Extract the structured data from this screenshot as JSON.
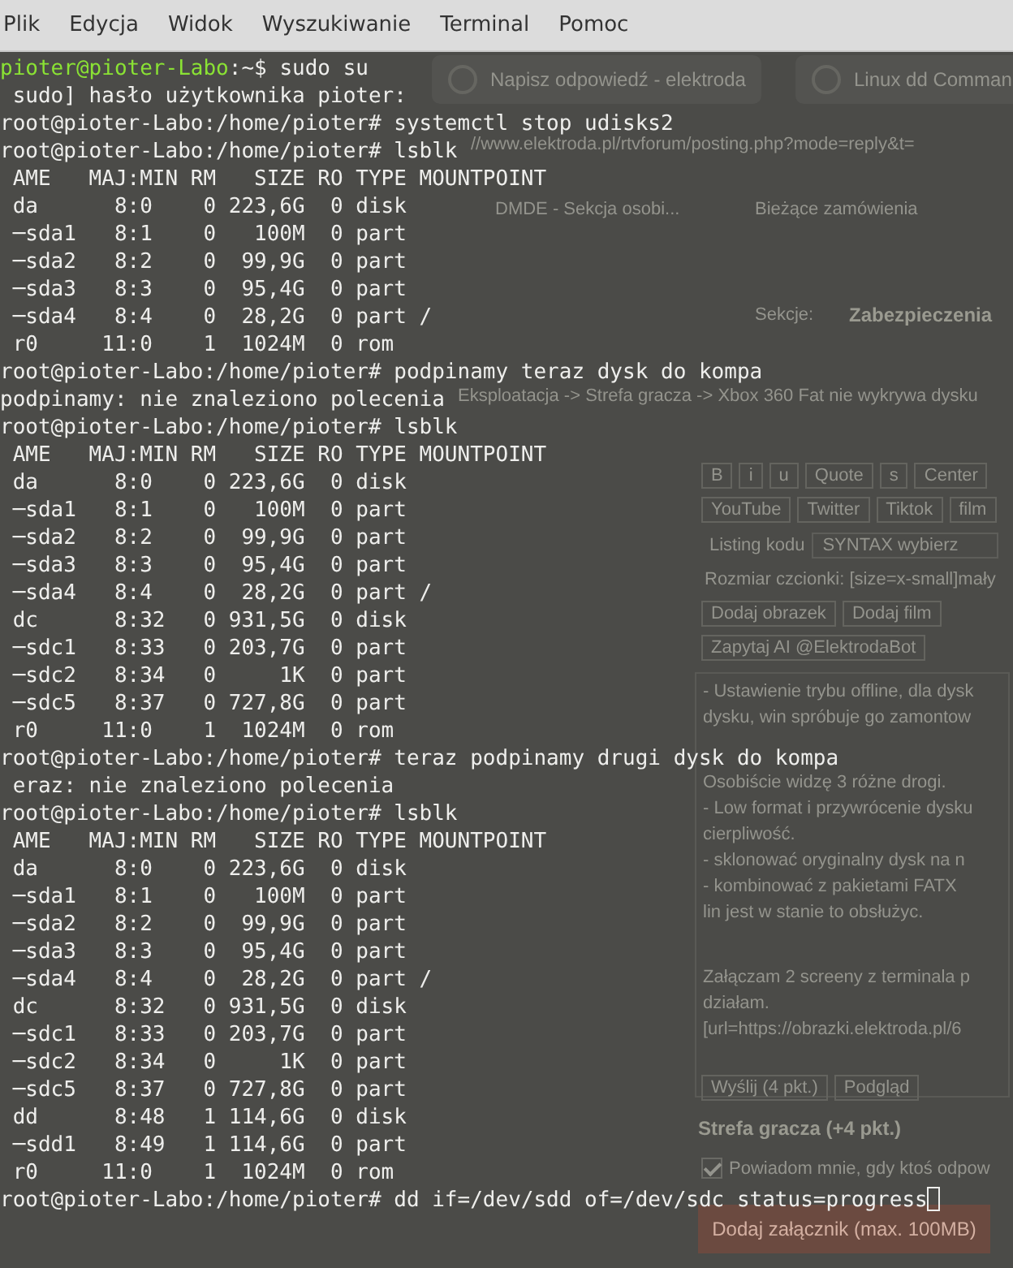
{
  "menu": [
    "Plik",
    "Edycja",
    "Widok",
    "Wyszukiwanie",
    "Terminal",
    "Pomoc"
  ],
  "background_window": [
    {
      "kind": "tab",
      "text": "Napisz odpowiedź - elektroda"
    },
    {
      "kind": "tab",
      "text": "Linux dd Comman"
    },
    {
      "kind": "url",
      "text": "//www.elektroda.pl/rtvforum/posting.php?mode=reply&t="
    },
    {
      "kind": "bookmark",
      "text": "DMDE - Sekcja osobi..."
    },
    {
      "kind": "bookmark",
      "text": "Bieżące zamówienia"
    },
    {
      "kind": "label",
      "text": "Sekcje:"
    },
    {
      "kind": "heading",
      "text": "Zabezpieczenia"
    },
    {
      "kind": "label",
      "text": "Eksploatacja -> Strefa gracza -> Xbox 360 Fat nie wykrywa dysku"
    },
    {
      "kind": "toolbar",
      "items": [
        "B",
        "i",
        "u",
        "Quote",
        "s",
        "Center"
      ]
    },
    {
      "kind": "toolbar",
      "items": [
        "YouTube",
        "Twitter",
        "Tiktok",
        "film"
      ]
    },
    {
      "kind": "select_row",
      "label": "Listing kodu",
      "value": "SYNTAX wybierz"
    },
    {
      "kind": "label",
      "text": "Rozmiar czcionki: [size=x-small]mały"
    },
    {
      "kind": "toolbar",
      "items": [
        "Dodaj obrazek",
        "Dodaj film"
      ]
    },
    {
      "kind": "toolbar",
      "items": [
        "Zapytaj AI @ElektrodaBot"
      ]
    },
    {
      "kind": "textarea",
      "paragraphs": [
        [
          "- Ustawienie trybu offline, dla dysk",
          "dysku, win spróbuje go zamontow"
        ],
        [
          "Osobiście widzę 3 różne drogi.",
          "- Low format i przywrócenie dysku",
          "cierpliwość.",
          "- sklonować oryginalny dysk na n",
          "- kombinować z pakietami FATX",
          "lin jest w stanie to obsłużyc."
        ],
        [
          "Załączam 2 screeny z terminala p",
          "działam.",
          "[url=https://obrazki.elektroda.pl/6"
        ]
      ]
    },
    {
      "kind": "toolbar",
      "items": [
        "Wyślij (4 pkt.)",
        "Podgląd"
      ]
    },
    {
      "kind": "heading",
      "text": "Strefa gracza (+4 pkt.)"
    },
    {
      "kind": "checkbox",
      "text": "Powiadom mnie, gdy ktoś odpow",
      "checked": true
    },
    {
      "kind": "submit",
      "text": "Dodaj załącznik (max. 100MB)"
    }
  ],
  "terminal": {
    "lines": [
      {
        "kind": "user_prompt",
        "user_host": "pioter@pioter-Labo",
        "prompt": ":~$",
        "command": "sudo su"
      },
      {
        "kind": "output",
        "text": " sudo] hasło użytkownika pioter:"
      },
      {
        "kind": "root_prompt",
        "text": "root@pioter-Labo:/home/pioter# systemctl stop udisks2"
      },
      {
        "kind": "root_prompt",
        "text": "root@pioter-Labo:/home/pioter# lsblk"
      },
      {
        "kind": "output",
        "text": " AME   MAJ:MIN RM   SIZE RO TYPE MOUNTPOINT"
      },
      {
        "kind": "output",
        "text": " da      8:0    0 223,6G  0 disk"
      },
      {
        "kind": "output",
        "text": " ─sda1   8:1    0   100M  0 part"
      },
      {
        "kind": "output",
        "text": " ─sda2   8:2    0  99,9G  0 part"
      },
      {
        "kind": "output",
        "text": " ─sda3   8:3    0  95,4G  0 part"
      },
      {
        "kind": "output",
        "text": " ─sda4   8:4    0  28,2G  0 part /"
      },
      {
        "kind": "output",
        "text": " r0     11:0    1  1024M  0 rom"
      },
      {
        "kind": "root_prompt",
        "text": "root@pioter-Labo:/home/pioter# podpinamy teraz dysk do kompa"
      },
      {
        "kind": "output",
        "text": "podpinamy: nie znaleziono polecenia"
      },
      {
        "kind": "root_prompt",
        "text": "root@pioter-Labo:/home/pioter# lsblk"
      },
      {
        "kind": "output",
        "text": " AME   MAJ:MIN RM   SIZE RO TYPE MOUNTPOINT"
      },
      {
        "kind": "output",
        "text": " da      8:0    0 223,6G  0 disk"
      },
      {
        "kind": "output",
        "text": " ─sda1   8:1    0   100M  0 part"
      },
      {
        "kind": "output",
        "text": " ─sda2   8:2    0  99,9G  0 part"
      },
      {
        "kind": "output",
        "text": " ─sda3   8:3    0  95,4G  0 part"
      },
      {
        "kind": "output",
        "text": " ─sda4   8:4    0  28,2G  0 part /"
      },
      {
        "kind": "output",
        "text": " dc      8:32   0 931,5G  0 disk"
      },
      {
        "kind": "output",
        "text": " ─sdc1   8:33   0 203,7G  0 part"
      },
      {
        "kind": "output",
        "text": " ─sdc2   8:34   0     1K  0 part"
      },
      {
        "kind": "output",
        "text": " ─sdc5   8:37   0 727,8G  0 part"
      },
      {
        "kind": "output",
        "text": " r0     11:0    1  1024M  0 rom"
      },
      {
        "kind": "root_prompt",
        "text": "root@pioter-Labo:/home/pioter# teraz podpinamy drugi dysk do kompa"
      },
      {
        "kind": "output",
        "text": " eraz: nie znaleziono polecenia"
      },
      {
        "kind": "root_prompt",
        "text": "root@pioter-Labo:/home/pioter# lsblk"
      },
      {
        "kind": "output",
        "text": " AME   MAJ:MIN RM   SIZE RO TYPE MOUNTPOINT"
      },
      {
        "kind": "output",
        "text": " da      8:0    0 223,6G  0 disk"
      },
      {
        "kind": "output",
        "text": " ─sda1   8:1    0   100M  0 part"
      },
      {
        "kind": "output",
        "text": " ─sda2   8:2    0  99,9G  0 part"
      },
      {
        "kind": "output",
        "text": " ─sda3   8:3    0  95,4G  0 part"
      },
      {
        "kind": "output",
        "text": " ─sda4   8:4    0  28,2G  0 part /"
      },
      {
        "kind": "output",
        "text": " dc      8:32   0 931,5G  0 disk"
      },
      {
        "kind": "output",
        "text": " ─sdc1   8:33   0 203,7G  0 part"
      },
      {
        "kind": "output",
        "text": " ─sdc2   8:34   0     1K  0 part"
      },
      {
        "kind": "output",
        "text": " ─sdc5   8:37   0 727,8G  0 part"
      },
      {
        "kind": "output",
        "text": " dd      8:48   1 114,6G  0 disk"
      },
      {
        "kind": "output",
        "text": " ─sdd1   8:49   1 114,6G  0 part"
      },
      {
        "kind": "output",
        "text": " r0     11:0    1  1024M  0 rom"
      },
      {
        "kind": "root_prompt",
        "text": "root@pioter-Labo:/home/pioter# dd if=/dev/sdd of=/dev/sdc status=progress",
        "cursor": true
      }
    ]
  }
}
